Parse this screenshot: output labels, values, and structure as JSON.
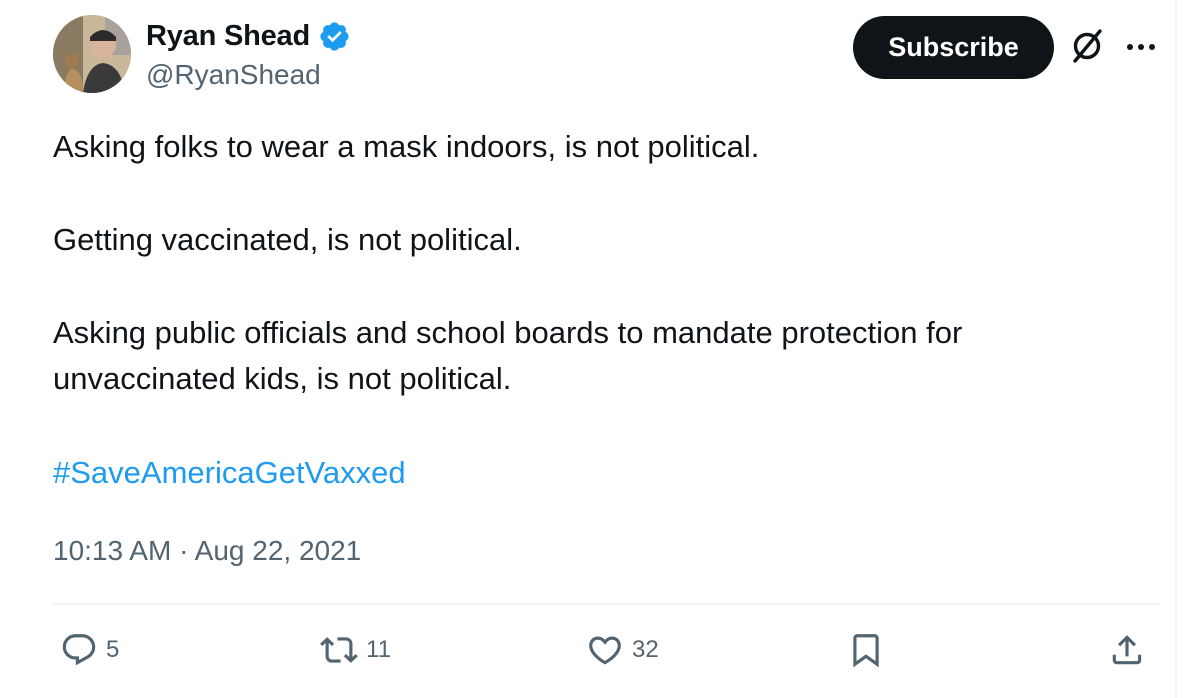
{
  "author": {
    "display_name": "Ryan Shead",
    "handle": "@RyanShead",
    "verified": true
  },
  "header": {
    "subscribe_label": "Subscribe",
    "icons": [
      "grok-icon",
      "more-icon"
    ]
  },
  "tweet": {
    "paragraphs": [
      "Asking folks to wear a mask indoors, is not political.",
      "Getting vaccinated, is not political.",
      "Asking public officials and school boards to mandate protection for unvaccinated kids, is not political."
    ],
    "hashtag": "#SaveAmericaGetVaxxed",
    "timestamp": "10:13 AM · Aug 22, 2021"
  },
  "actions": {
    "replies": "5",
    "reposts": "11",
    "likes": "32"
  },
  "colors": {
    "link": "#1d9bf0",
    "muted": "#536471",
    "text": "#0f1419",
    "verified": "#1d9bf0"
  }
}
